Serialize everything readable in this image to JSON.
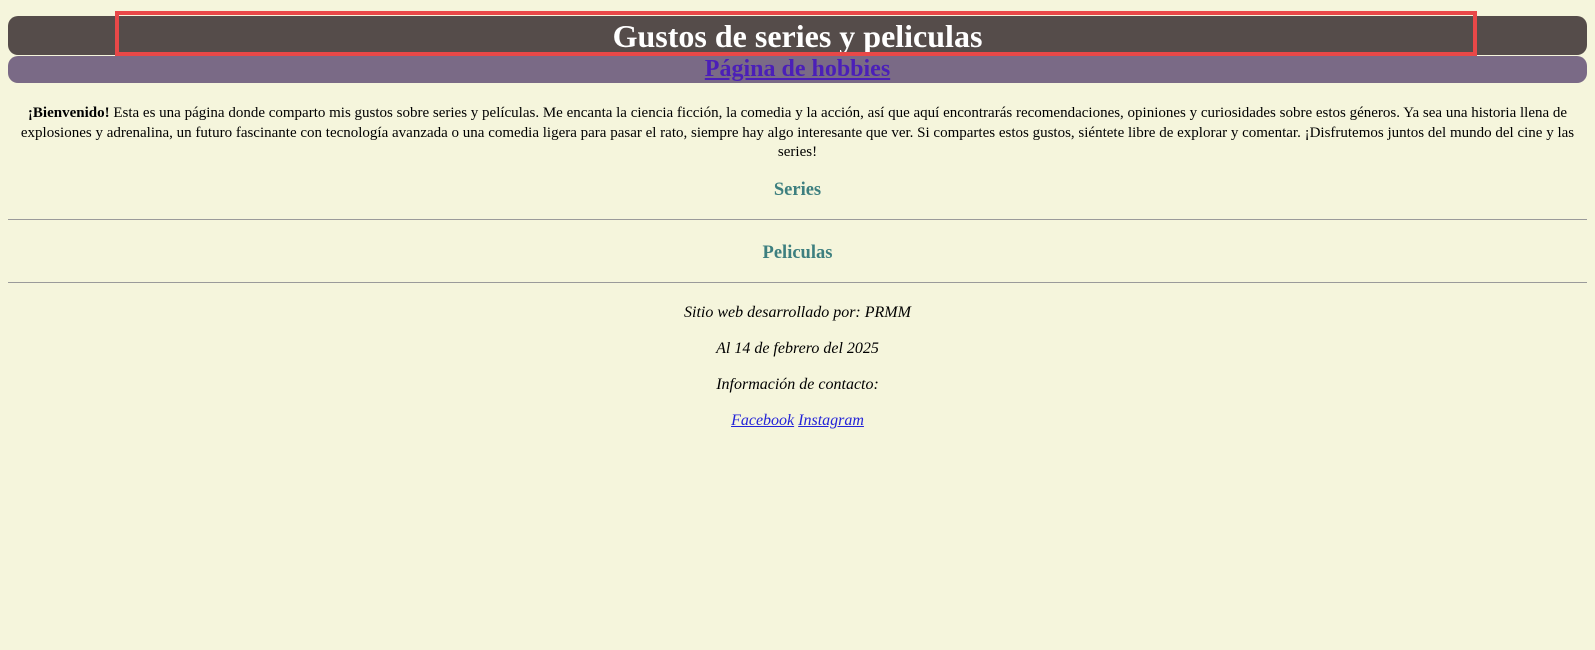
{
  "header": {
    "title": "Gustos de series y peliculas"
  },
  "nav": {
    "hobbies_link": "Página de hobbies"
  },
  "intro": {
    "welcome": "¡Bienvenido!",
    "text": " Esta es una página donde comparto mis gustos sobre series y películas. Me encanta la ciencia ficción, la comedia y la acción, así que aquí encontrarás recomendaciones, opiniones y curiosidades sobre estos géneros. Ya sea una historia llena de explosiones y adrenalina, un futuro fascinante con tecnología avanzada o una comedia ligera para pasar el rato, siempre hay algo interesante que ver. Si compartes estos gustos, siéntete libre de explorar y comentar. ¡Disfrutemos juntos del mundo del cine y las series!"
  },
  "sections": {
    "series": "Series",
    "peliculas": "Peliculas"
  },
  "footer": {
    "developer": "Sitio web desarrollado por: PRMM",
    "date": "Al 14 de febrero del 2025",
    "contact": "Información de contacto:",
    "facebook": "Facebook",
    "instagram": "Instagram"
  },
  "colors": {
    "background": "#f5f5dc",
    "header_bg": "#554c4a",
    "nav_bg": "#7a6a86",
    "section_title": "#3d7f7f",
    "highlight": "#e84848"
  }
}
